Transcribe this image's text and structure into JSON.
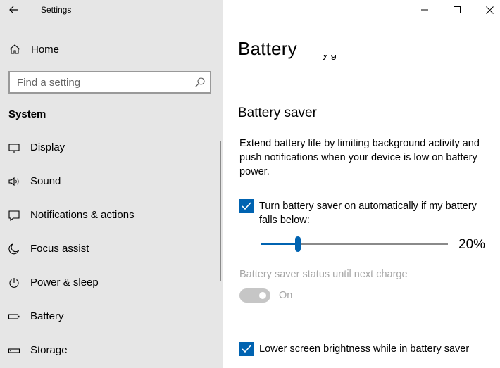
{
  "window": {
    "title": "Settings"
  },
  "sidebar": {
    "home_label": "Home",
    "search_placeholder": "Find a setting",
    "section": "System",
    "items": [
      {
        "label": "Display",
        "icon": "monitor-icon"
      },
      {
        "label": "Sound",
        "icon": "speaker-icon"
      },
      {
        "label": "Notifications & actions",
        "icon": "notification-icon"
      },
      {
        "label": "Focus assist",
        "icon": "moon-icon"
      },
      {
        "label": "Power & sleep",
        "icon": "power-icon"
      },
      {
        "label": "Battery",
        "icon": "battery-icon"
      },
      {
        "label": "Storage",
        "icon": "storage-icon"
      }
    ]
  },
  "main": {
    "title": "Battery",
    "clipped_text": "y g",
    "battery_saver": {
      "header": "Battery saver",
      "description": "Extend battery life by limiting background activity and push notifications when your device is low on battery power.",
      "auto_checkbox_label": "Turn battery saver on automatically if my battery falls below:",
      "auto_checked": true,
      "threshold_value": 20,
      "threshold_label": "20%",
      "status_label": "Battery saver status until next charge",
      "status_toggle_label": "On",
      "status_toggle_on": true,
      "brightness_checkbox_label": "Lower screen brightness while in battery saver",
      "brightness_checked": true
    }
  },
  "colors": {
    "accent": "#0063b1",
    "sidebar_bg": "#e6e6e6",
    "disabled": "#a6a6a6"
  }
}
